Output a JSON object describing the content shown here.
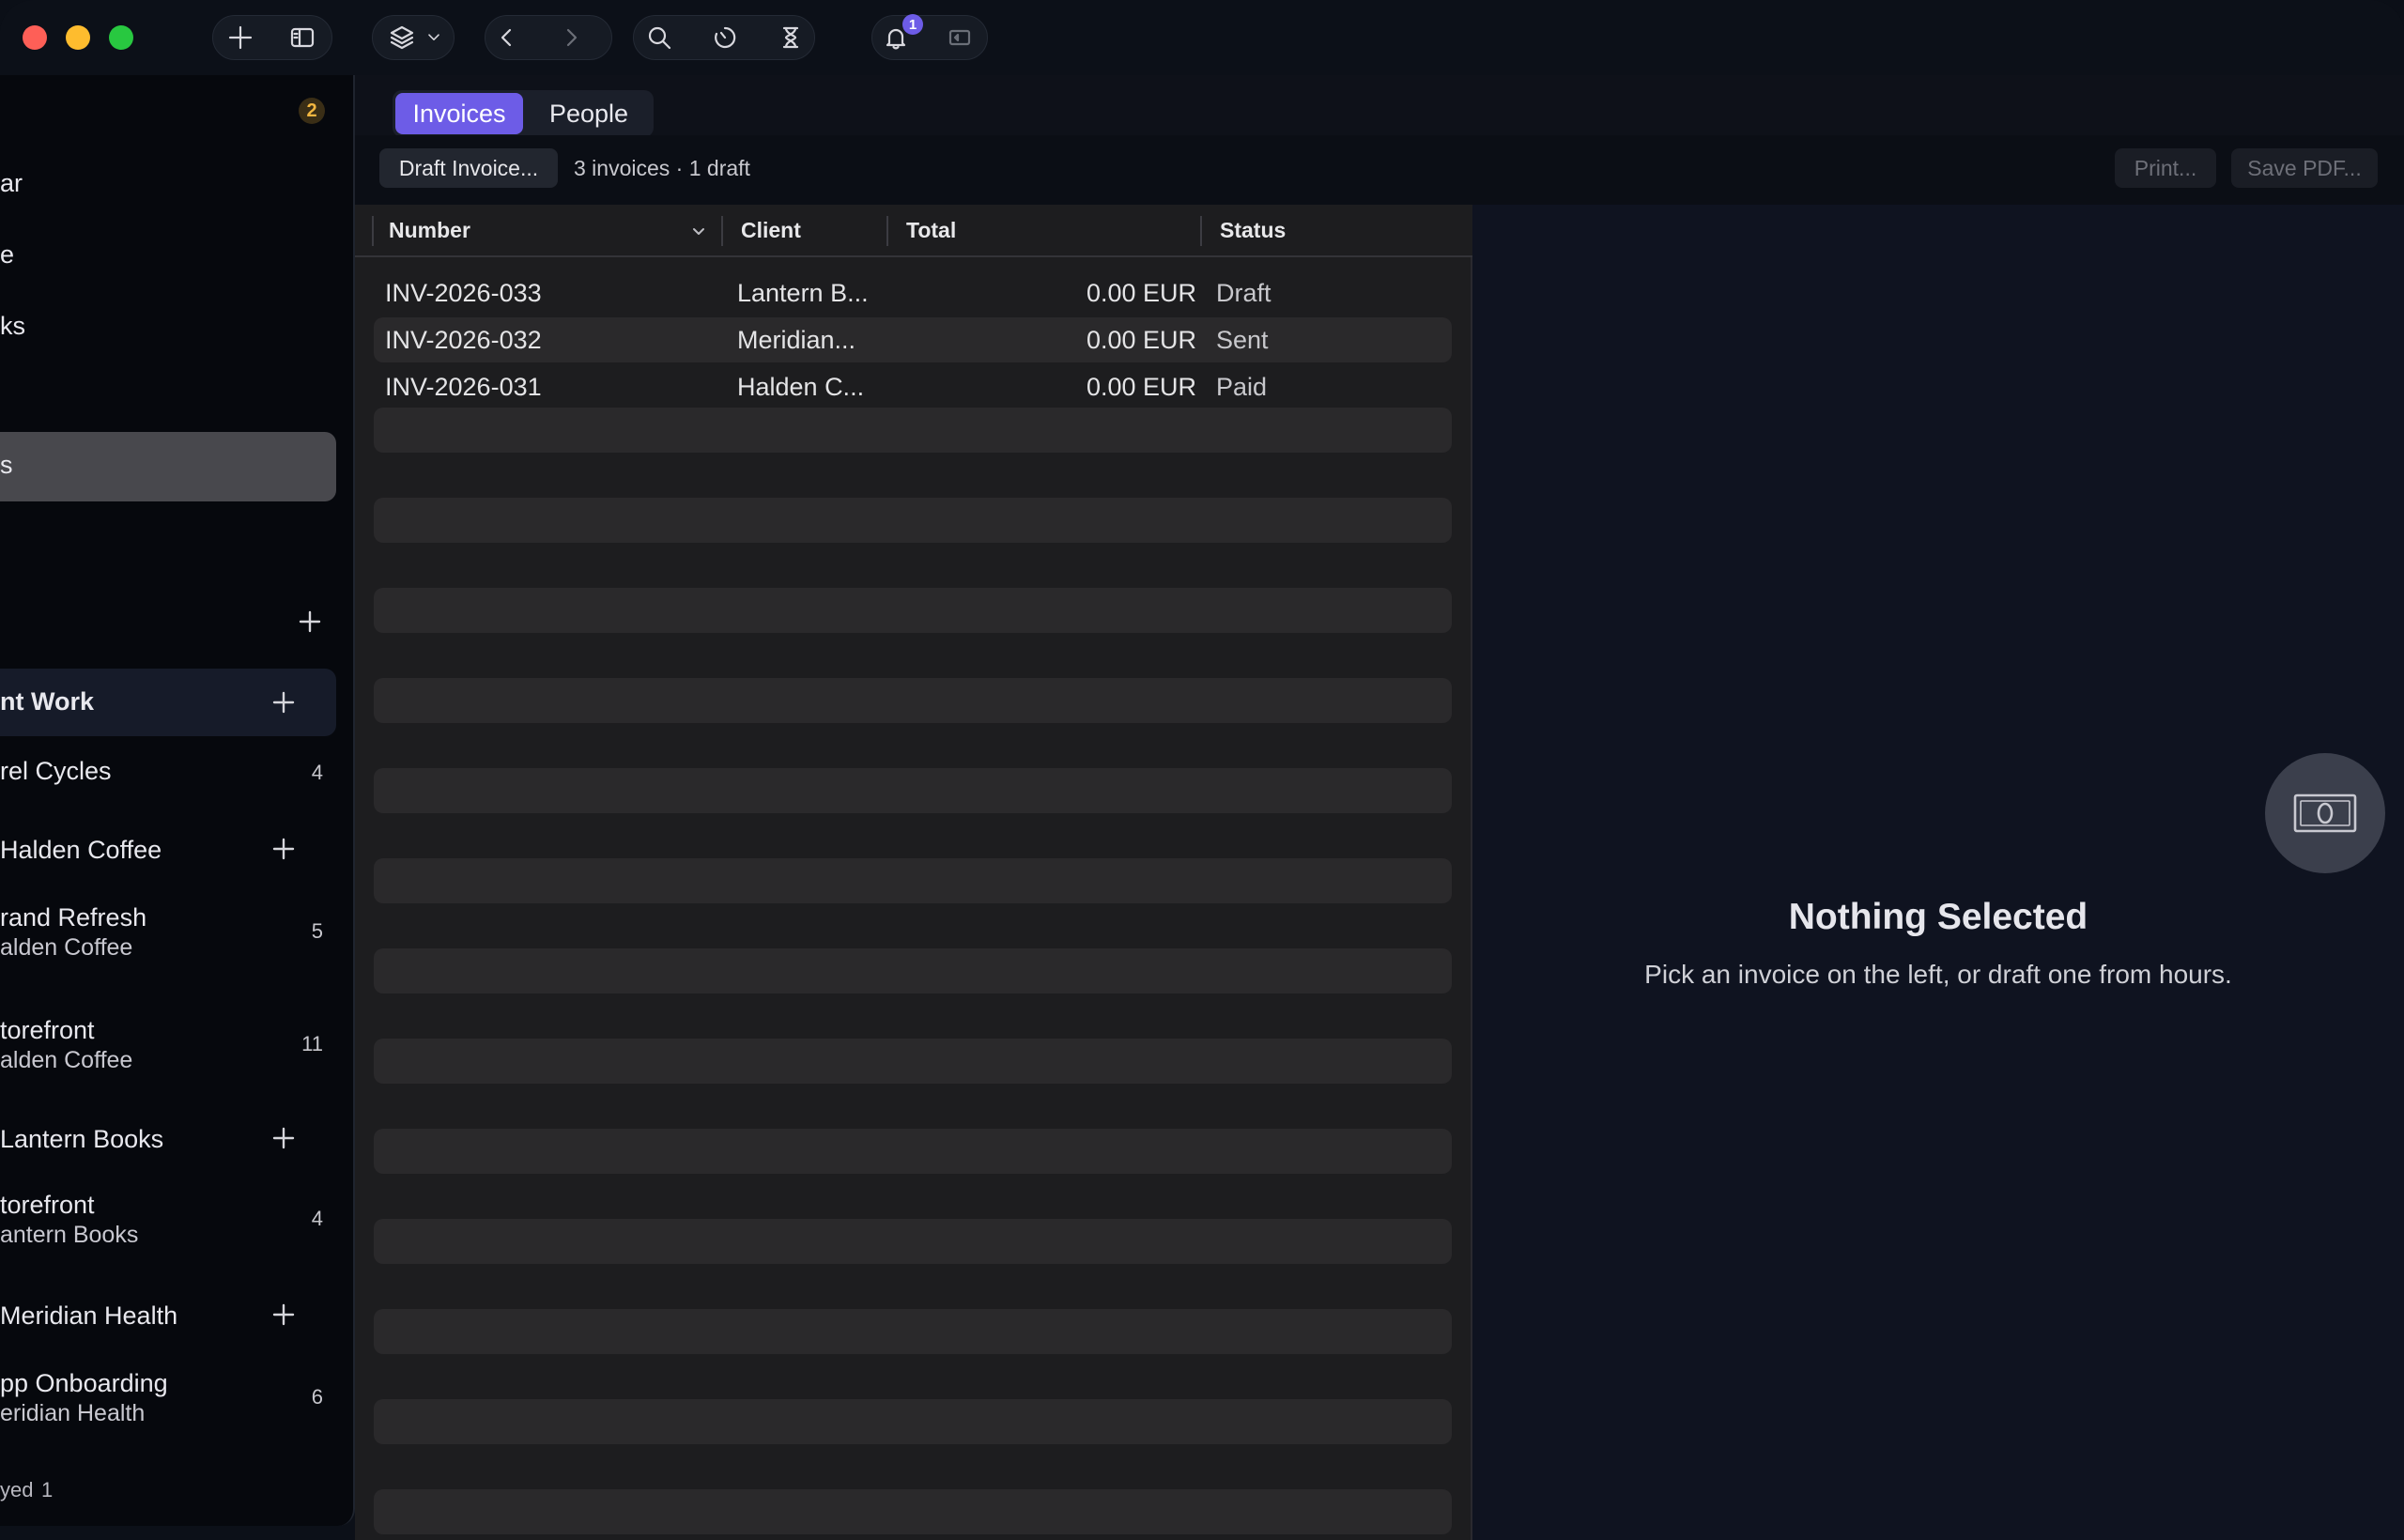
{
  "toolbar_icons": {
    "new": "plus-icon",
    "sidebar_toggle": "sidebar-icon",
    "layers": "layers-icon",
    "back": "chevron-left-icon",
    "forward": "chevron-right-icon",
    "search": "search-icon",
    "timer": "timer-icon",
    "hourglass": "hourglass-icon",
    "notifications": "bell-icon",
    "sync": "sync-icon"
  },
  "notifications_badge": "1",
  "sidebar": {
    "top_badge": "2",
    "nav_items": [
      {
        "label": "ar"
      },
      {
        "label": "e"
      },
      {
        "label": "ks"
      }
    ],
    "selected_item": {
      "label": "s"
    },
    "section_header": {
      "label": "nt Work"
    },
    "projects": [
      {
        "title": "rel Cycles",
        "subtitle": "",
        "count": "4"
      },
      {
        "title": "Halden Coffee",
        "subtitle": "",
        "count": ""
      },
      {
        "title": "rand Refresh",
        "subtitle": "alden Coffee",
        "count": "5"
      },
      {
        "title": "torefront",
        "subtitle": "alden Coffee",
        "count": "11"
      },
      {
        "title": "Lantern Books",
        "subtitle": "",
        "count": ""
      },
      {
        "title": "torefront",
        "subtitle": "antern Books",
        "count": "4"
      },
      {
        "title": "Meridian Health",
        "subtitle": "",
        "count": ""
      },
      {
        "title": "pp Onboarding",
        "subtitle": "eridian Health",
        "count": "6"
      }
    ],
    "footer": {
      "label": "yed",
      "count": "1"
    }
  },
  "tabs": [
    {
      "label": "Invoices",
      "active": true
    },
    {
      "label": "People",
      "active": false
    }
  ],
  "toolbar": {
    "draft_button": "Draft Invoice...",
    "summary": "3 invoices · 1 draft",
    "print_button": "Print...",
    "save_pdf_button": "Save PDF..."
  },
  "table": {
    "columns": [
      "Number",
      "Client",
      "Total",
      "Status"
    ],
    "rows": [
      {
        "number": "INV-2026-033",
        "client": "Lantern B...",
        "total": "0.00 EUR",
        "status": "Draft"
      },
      {
        "number": "INV-2026-032",
        "client": "Meridian...",
        "total": "0.00 EUR",
        "status": "Sent"
      },
      {
        "number": "INV-2026-031",
        "client": "Halden C...",
        "total": "0.00 EUR",
        "status": "Paid"
      }
    ]
  },
  "empty_state": {
    "icon": "banknote-icon",
    "title": "Nothing Selected",
    "subtitle": "Pick an invoice on the left, or draft one from hours."
  },
  "colors": {
    "accent": "#6d5ce7",
    "traffic_red": "#fe5f57",
    "traffic_yellow": "#febc2e",
    "traffic_green": "#28c840"
  }
}
